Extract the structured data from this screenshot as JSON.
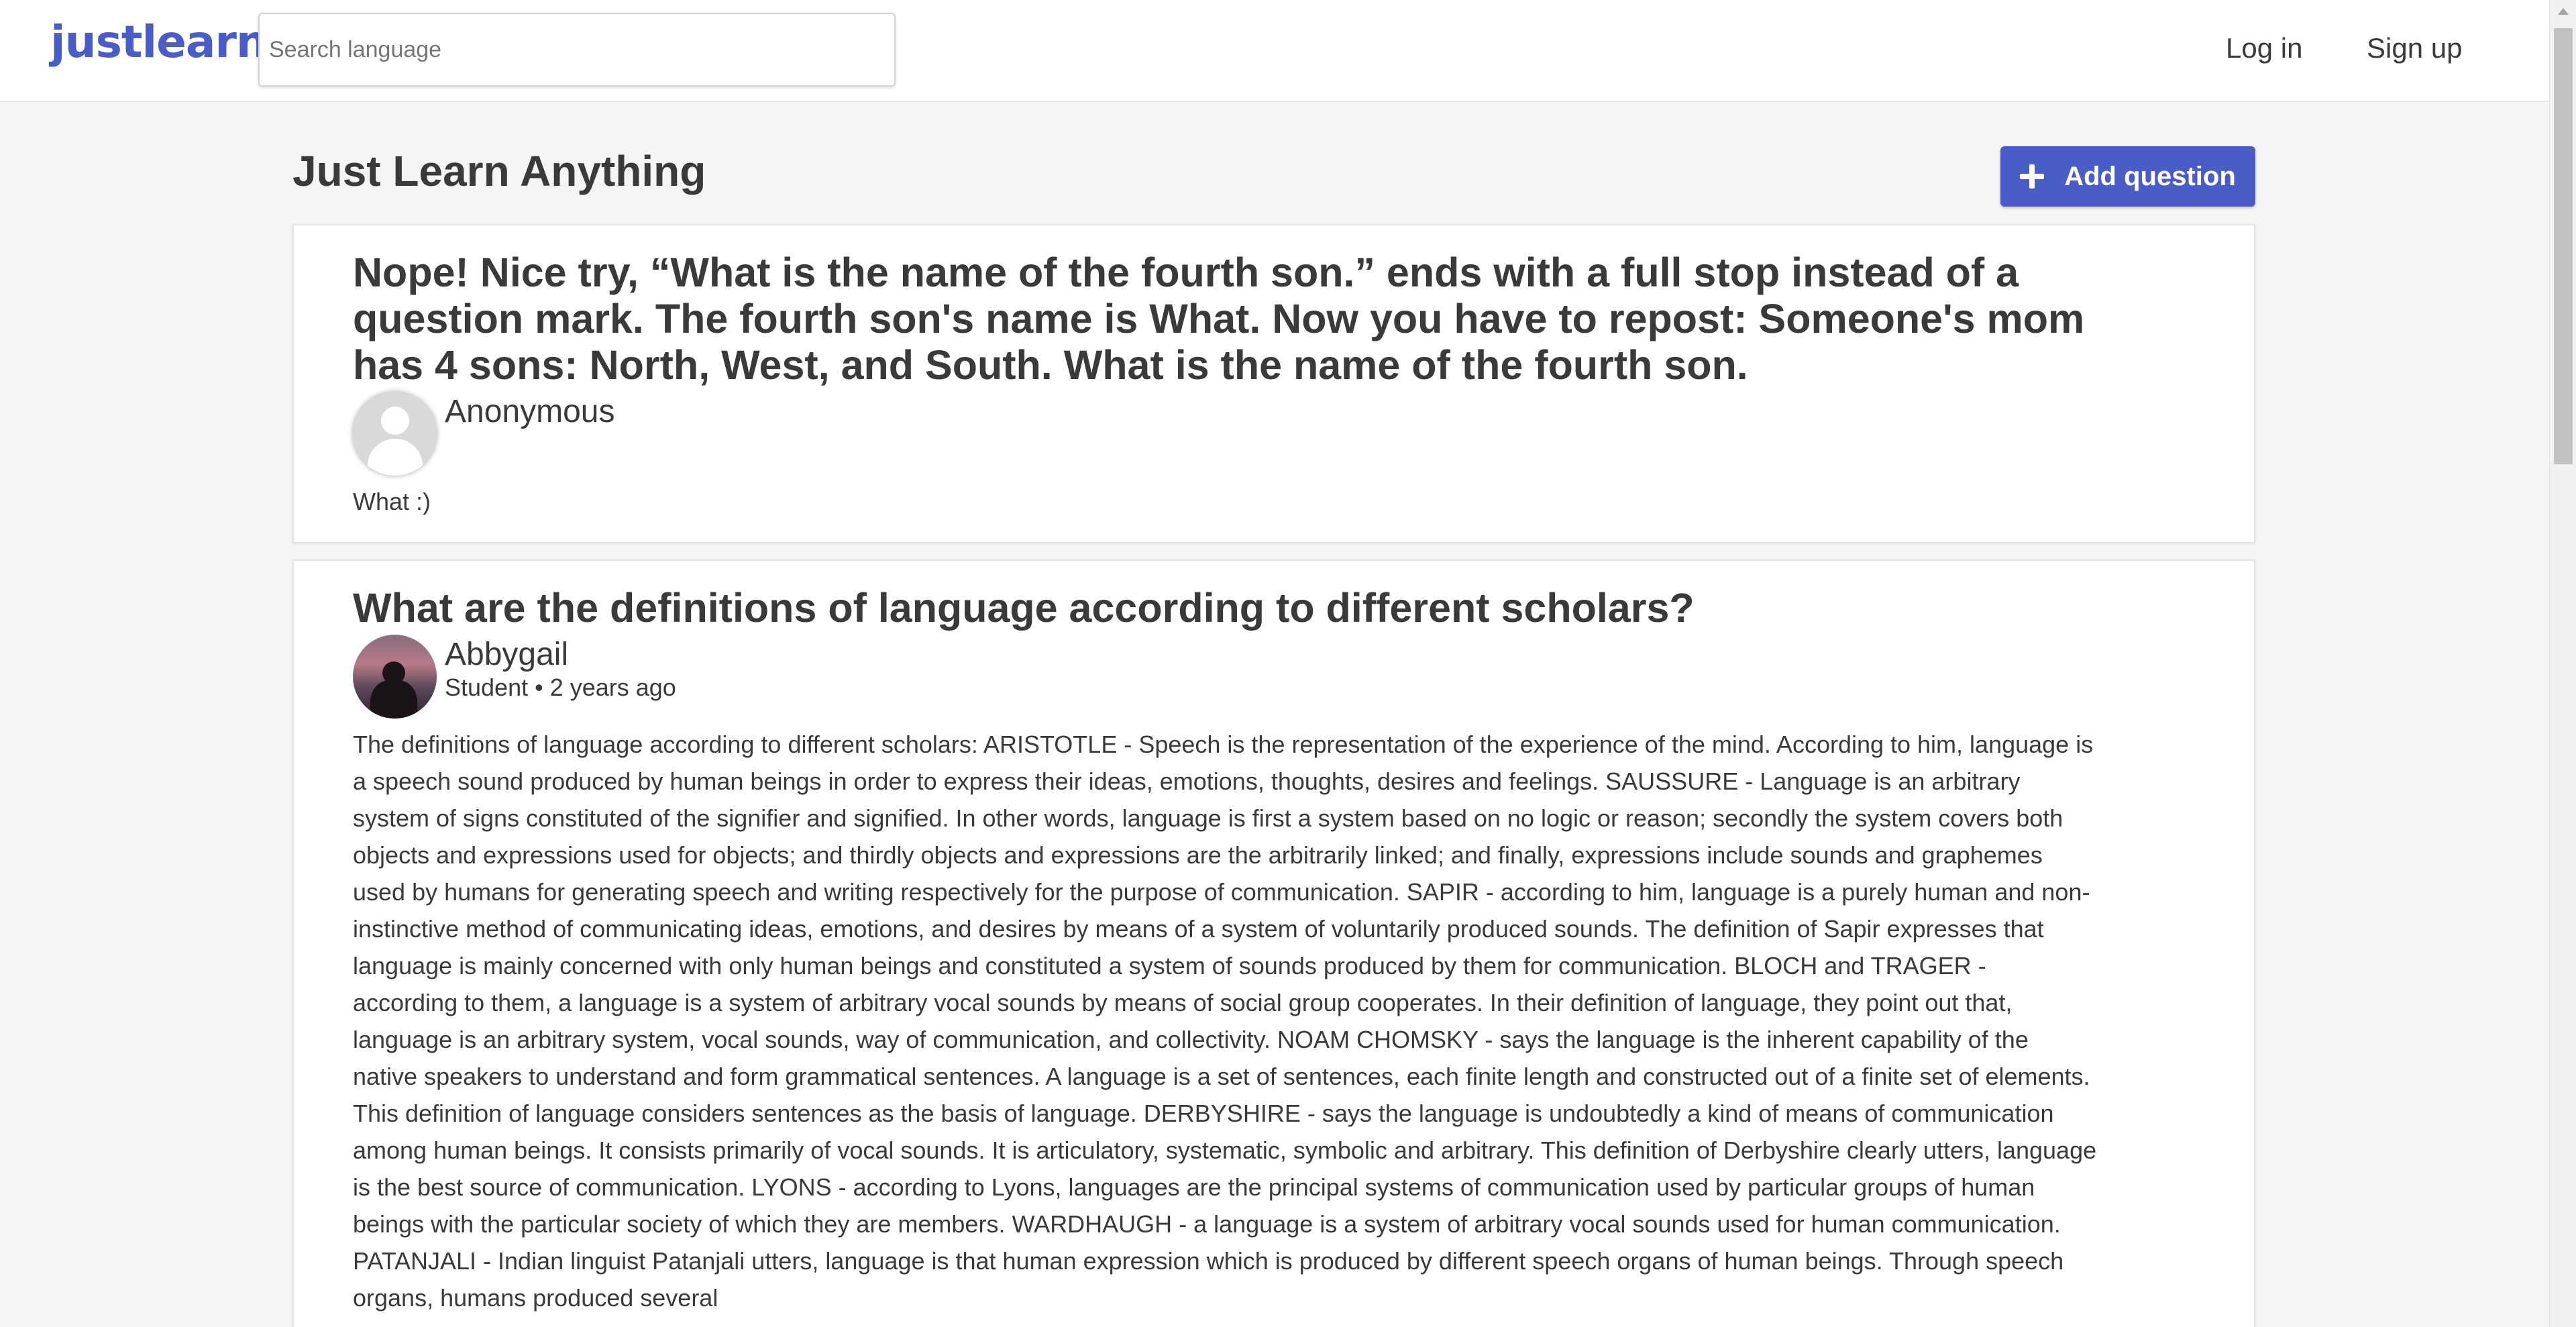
{
  "header": {
    "logo": "justlearn",
    "search_placeholder": "Search language",
    "login_label": "Log in",
    "signup_label": "Sign up"
  },
  "main": {
    "title": "Just Learn Anything",
    "add_question_label": "Add question"
  },
  "questions": [
    {
      "title": "Nope! Nice try, “What is the name of the fourth son.” ends with a full stop instead of a question mark. The fourth son's name is What. Now you have to repost: Someone's mom has 4 sons: North, West, and South. What is the name of the fourth son.",
      "author": "Anonymous",
      "answer": "What :)"
    },
    {
      "title": "What are the definitions of language according to different scholars?",
      "author": "Abbygail",
      "meta": "Student • 2 years ago",
      "answer": "The definitions of language according to different scholars: ARISTOTLE - Speech is the representation of the experience of the mind. According to him, language is a speech sound produced by human beings in order to express their ideas, emotions, thoughts, desires and feelings. SAUSSURE - Language is an arbitrary system of signs constituted of the signifier and signified. In other words, language is first a system based on no logic or reason; secondly the system covers both objects and expressions used for objects; and thirdly objects and expressions are the arbitrarily linked; and finally, expressions include sounds and graphemes used by humans for generating speech and writing respectively for the purpose of communication. SAPIR - according to him, language is a purely human and non-instinctive method of communicating ideas, emotions, and desires by means of a system of voluntarily produced sounds. The definition of Sapir expresses that language is mainly concerned with only human beings and constituted a system of sounds produced by them for communication. BLOCH and TRAGER - according to them, a language is a system of arbitrary vocal sounds by means of social group cooperates. In their definition of language, they point out that, language is an arbitrary system, vocal sounds, way of communication, and collectivity. NOAM CHOMSKY - says the language is the inherent capability of the native speakers to understand and form grammatical sentences. A language is a set of sentences, each finite length and constructed out of a finite set of elements. This definition of language considers sentences as the basis of language. DERBYSHIRE - says the language is undoubtedly a kind of means of communication among human beings. It consists primarily of vocal sounds. It is articulatory, systematic, symbolic and arbitrary. This definition of Derbyshire clearly utters, language is the best source of communication. LYONS - according to Lyons, languages are the principal systems of communication used by particular groups of human beings with the particular society of which they are members. WARDHAUGH - a language is a system of arbitrary vocal sounds used for human communication. PATANJALI - Indian linguist Patanjali utters, language is that human expression which is produced by different speech organs of human beings. Through speech organs, humans produced several"
    }
  ],
  "colors": {
    "brand": "#4a5dc7",
    "text": "#3a3a3a",
    "background": "#f5f5f5"
  }
}
